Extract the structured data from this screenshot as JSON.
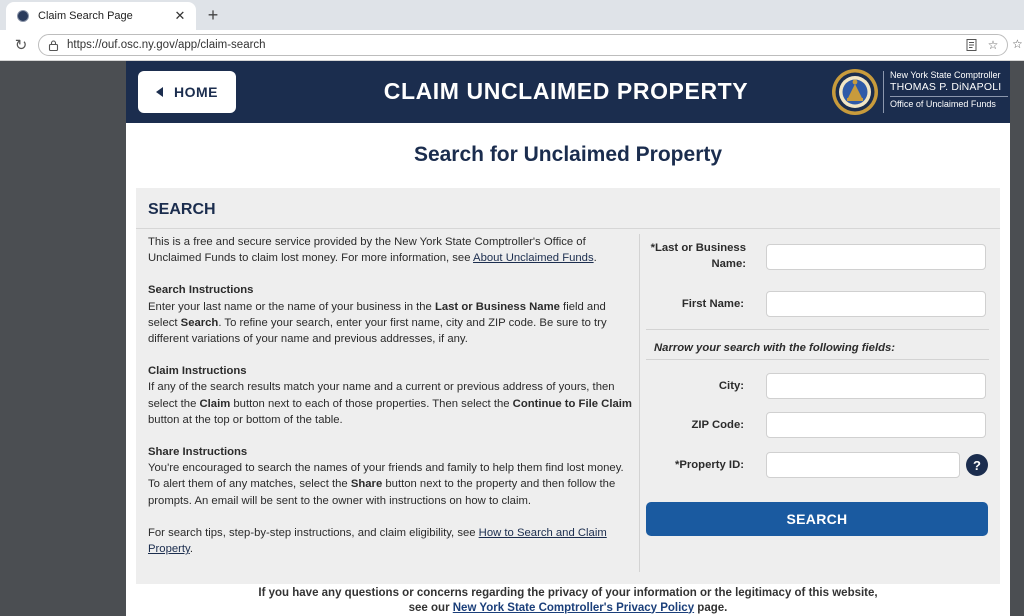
{
  "browser": {
    "tab_title": "Claim Search Page",
    "tab_close": "✕",
    "new_tab": "+",
    "url": "https://ouf.osc.ny.gov/app/claim-search"
  },
  "header": {
    "home_label": "HOME",
    "site_title": "CLAIM UNCLAIMED PROPERTY",
    "logo_line1": "New York State Comptroller",
    "logo_line2": "THOMAS P. DiNAPOLI",
    "logo_line3": "Office of Unclaimed Funds",
    "background_color": "#1b2d4e"
  },
  "main": {
    "page_title": "Search for Unclaimed Property",
    "panel_heading": "SEARCH",
    "intro_text": "This is a free and secure service provided by the New York State Comptroller's Office of Unclaimed Funds to claim lost money. For more information, see ",
    "intro_link": "About Unclaimed Funds",
    "intro_end": ".",
    "search_instructions": {
      "heading": "Search Instructions",
      "t1": "Enter your last name or the name of your business in the ",
      "b1": "Last or Business Name",
      "t2": " field and select ",
      "b2": "Search",
      "t3": ". To refine your search, enter your first name, city and ZIP code. Be sure to try different variations of your name and previous addresses, if any."
    },
    "claim_instructions": {
      "heading": "Claim Instructions",
      "t1": "If any of the search results match your name and a current or previous address of yours, then select the ",
      "b1": "Claim",
      "t2": " button next to each of those properties. Then select the ",
      "b2": "Continue to File Claim",
      "t3": " button at the top or bottom of the table."
    },
    "share_instructions": {
      "heading": "Share Instructions",
      "t1": "You're encouraged to search the names of your friends and family to help them find lost money. To alert them of any matches, select the ",
      "b1": "Share",
      "t2": " button next to the property and then follow the prompts. An email will be sent to the owner with instructions on how to claim."
    },
    "tips_text": "For search tips, step-by-step instructions, and claim eligibility, see ",
    "tips_link": "How to Search and Claim Property",
    "tips_end": "."
  },
  "form": {
    "last_name_label_1": "*Last or Business",
    "last_name_label_2": "Name:",
    "last_name_value": "",
    "first_name_label": "First Name:",
    "first_name_value": "",
    "narrow_text": "Narrow your search with the following fields:",
    "city_label": "City:",
    "city_value": "",
    "zip_label": "ZIP Code:",
    "zip_value": "",
    "property_id_label": "*Property ID:",
    "property_id_value": "",
    "help_label": "?",
    "search_button": "SEARCH",
    "search_button_color": "#1a5aa0"
  },
  "footer": {
    "line1": "If you have any questions or concerns regarding the privacy of your information or the legitimacy of this website,",
    "line2_start": "see our ",
    "privacy_link": "New York State Comptroller's Privacy Policy",
    "line2_end": " page."
  }
}
